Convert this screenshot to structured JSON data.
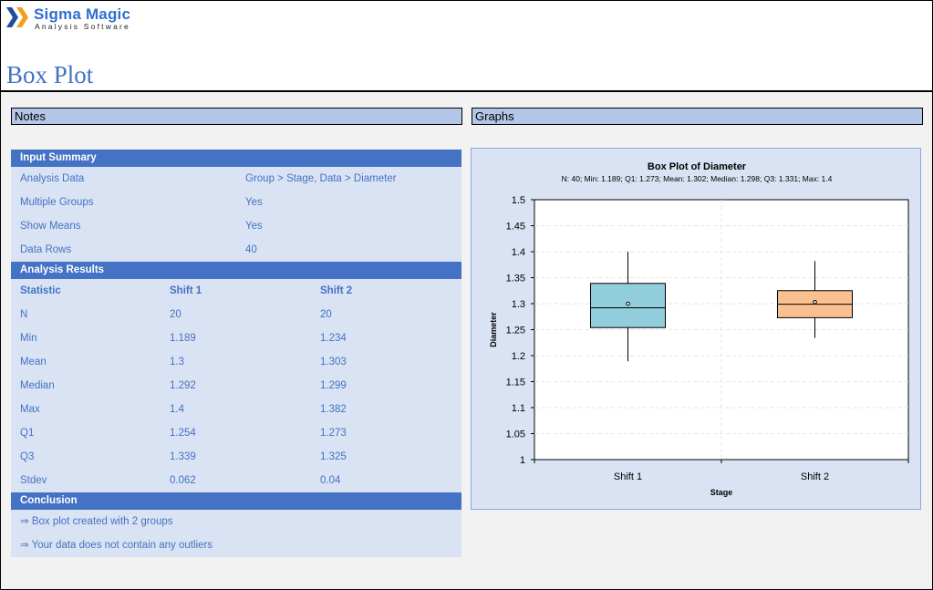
{
  "logo": {
    "brand": "Sigma Magic",
    "tagline": "Analysis Software"
  },
  "page_title": "Box Plot",
  "sections": {
    "notes": "Notes",
    "graphs": "Graphs"
  },
  "input_summary": {
    "title": "Input Summary",
    "rows": [
      {
        "label": "Analysis Data",
        "value": "Group > Stage, Data > Diameter"
      },
      {
        "label": "Multiple Groups",
        "value": "Yes"
      },
      {
        "label": "Show Means",
        "value": "Yes"
      },
      {
        "label": "Data Rows",
        "value": "40"
      }
    ]
  },
  "analysis_results": {
    "title": "Analysis Results",
    "headers": [
      "Statistic",
      "Shift 1",
      "Shift 2"
    ],
    "rows": [
      [
        "N",
        "20",
        "20"
      ],
      [
        "Min",
        "1.189",
        "1.234"
      ],
      [
        "Mean",
        "1.3",
        "1.303"
      ],
      [
        "Median",
        "1.292",
        "1.299"
      ],
      [
        "Max",
        "1.4",
        "1.382"
      ],
      [
        "Q1",
        "1.254",
        "1.273"
      ],
      [
        "Q3",
        "1.339",
        "1.325"
      ],
      [
        "Stdev",
        "0.062",
        "0.04"
      ]
    ]
  },
  "conclusion": {
    "title": "Conclusion",
    "items": [
      "⇒ Box plot created with 2 groups",
      "⇒ Your data does not contain any outliers"
    ]
  },
  "chart_data": {
    "type": "box",
    "title": "Box Plot of Diameter",
    "subtitle": "N: 40; Min: 1.189; Q1: 1.273; Mean: 1.302; Median: 1.298; Q3: 1.331; Max: 1.4",
    "xlabel": "Stage",
    "ylabel": "Diameter",
    "ylim": [
      1,
      1.5
    ],
    "yticks": [
      "1",
      "1.05",
      "1.1",
      "1.15",
      "1.2",
      "1.25",
      "1.3",
      "1.35",
      "1.4",
      "1.45",
      "1.5"
    ],
    "categories": [
      "Shift 1",
      "Shift 2"
    ],
    "series": [
      {
        "min": 1.189,
        "q1": 1.254,
        "median": 1.292,
        "q3": 1.339,
        "max": 1.4,
        "mean": 1.3,
        "color": "#92cddc"
      },
      {
        "min": 1.234,
        "q1": 1.273,
        "median": 1.299,
        "q3": 1.325,
        "max": 1.382,
        "mean": 1.303,
        "color": "#fac090"
      }
    ],
    "grid": true
  }
}
